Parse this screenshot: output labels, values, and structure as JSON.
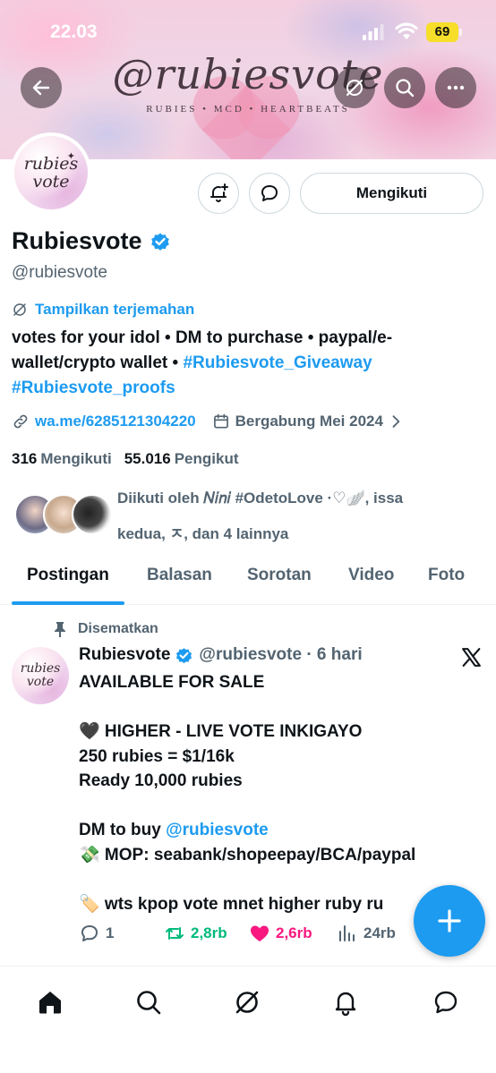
{
  "status_bar": {
    "time": "22.03",
    "battery": "69",
    "icons": [
      "signal-icon",
      "wifi-icon",
      "battery-icon"
    ]
  },
  "banner": {
    "title": "@rubiesvote",
    "subtitle": "RUBIES • MCD • HEARTBEATS"
  },
  "avatar": {
    "text_line1": "rubies",
    "text_line2": "vote"
  },
  "header_buttons": [
    "back-icon",
    "translate-icon",
    "search-icon",
    "more-icon"
  ],
  "profile": {
    "follow_label": "Mengikuti",
    "display_name": "Rubiesvote",
    "handle": "@rubiesvote",
    "translate_label": "Tampilkan terjemahan",
    "bio_text": "votes for your idol • DM to purchase • paypal/e-wallet/crypto wallet • ",
    "bio_hashtag1": "#Rubiesvote_Giveaway",
    "bio_hashtag2": "#Rubiesvote_proofs",
    "link": "wa.me/6285121304220",
    "joined": "Bergabung Mei 2024",
    "following_count": "316",
    "following_label": "Mengikuti",
    "followers_count": "55.016",
    "followers_label": "Pengikut",
    "followed_by_line1": "Diikuti oleh 𝑁𝑖𝑛𝑖 #OdetoLove ·♡🪽, issa",
    "followed_by_line2": "kedua, ㅈ, dan 4 lainnya"
  },
  "tabs": [
    {
      "label": "Postingan",
      "active": true
    },
    {
      "label": "Balasan",
      "active": false
    },
    {
      "label": "Sorotan",
      "active": false
    },
    {
      "label": "Video",
      "active": false
    },
    {
      "label": "Foto",
      "active": false
    }
  ],
  "pinned_tweet": {
    "pinned_label": "Disematkan",
    "avatar_line1": "rubies",
    "avatar_line2": "vote",
    "name": "Rubiesvote",
    "handle_time": "@rubiesvote · 6 hari",
    "lines": {
      "l1": "AVAILABLE FOR SALE",
      "l2": "🖤 HIGHER - LIVE VOTE INKIGAYO",
      "l3": "250 rubies = $1/16k",
      "l4": "Ready 10,000 rubies",
      "l5_prefix": "DM to buy ",
      "l5_mention": "@rubiesvote",
      "l6": "💸 MOP: seabank/shopeepay/BCA/paypal",
      "l7": "🏷️ wts kpop vote mnet higher ruby ru"
    },
    "replies": "1",
    "retweets": "2,8rb",
    "likes": "2,6rb",
    "views": "24rb"
  },
  "fab_icon": "plus-icon",
  "bottom_nav": [
    "home-icon",
    "search-icon",
    "grok-icon",
    "notifications-icon",
    "messages-icon"
  ],
  "colors": {
    "accent": "#1d9bf0",
    "text": "#0f1419",
    "muted": "#536471",
    "retweet": "#00ba7c",
    "like": "#f91880",
    "battery": "#f6de2a"
  }
}
